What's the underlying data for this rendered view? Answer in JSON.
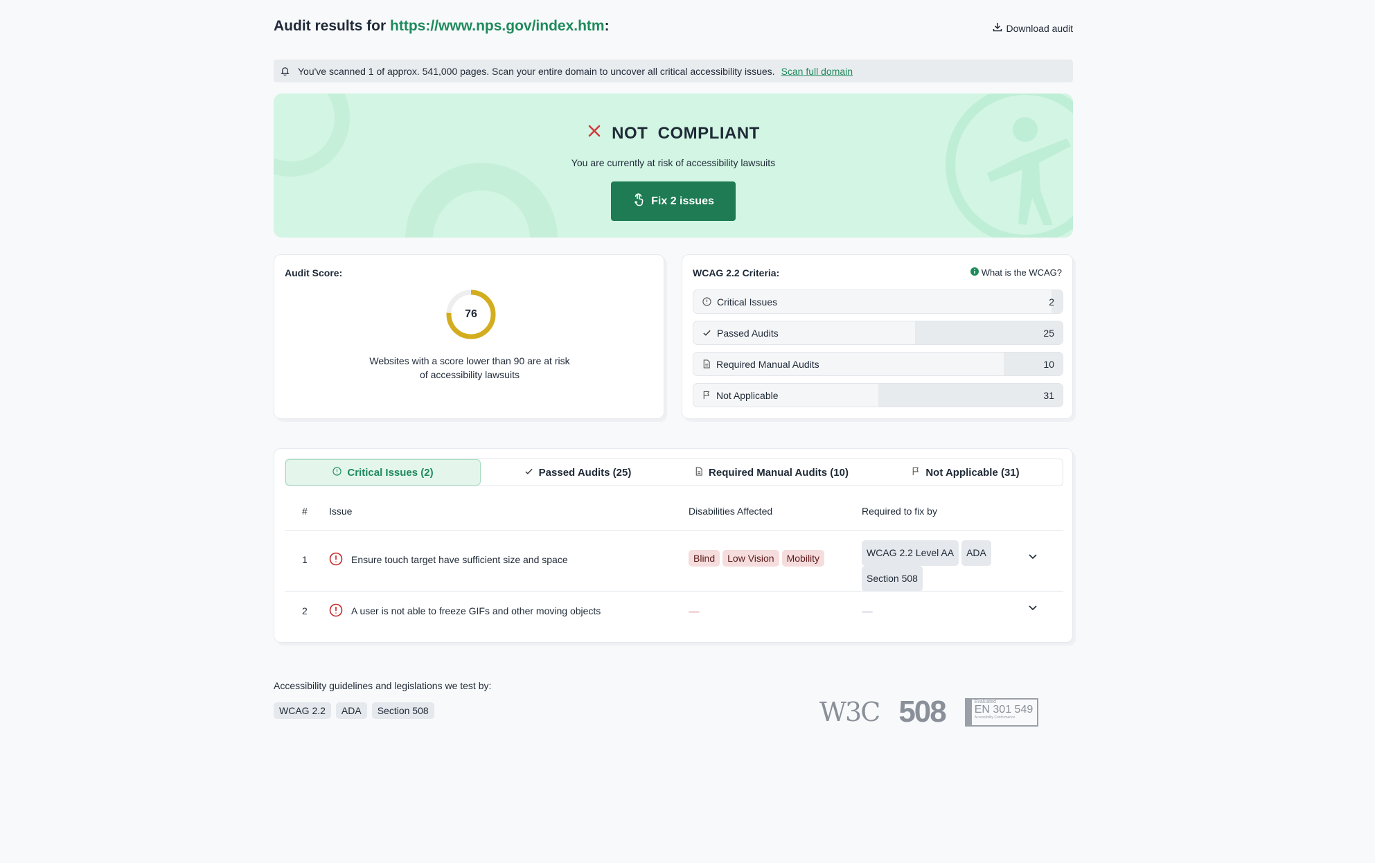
{
  "header": {
    "title_prefix": "Audit results for",
    "url": "https://www.nps.gov/index.htm",
    "title_suffix": ":",
    "download_label": "Download audit"
  },
  "notice": {
    "text": "You've scanned 1 of approx. 541,000 pages. Scan your entire domain to uncover all critical accessibility issues.",
    "link": "Scan full domain"
  },
  "hero": {
    "status": "NOT  COMPLIANT",
    "subtitle": "You are currently at risk of accessibility lawsuits",
    "fix_button": "Fix 2 issues"
  },
  "score_card": {
    "title": "Audit Score:",
    "score": 76,
    "score_label": "76",
    "note_line1": "Websites with a score lower than 90 are at risk",
    "note_line2": "of accessibility lawsuits"
  },
  "wcag_card": {
    "title": "WCAG 2.2 Criteria:",
    "link": "What is the WCAG?",
    "rows": [
      {
        "label": "Critical Issues",
        "count": "2",
        "fraction": 0.03
      },
      {
        "label": "Passed Audits",
        "count": "25",
        "fraction": 0.4
      },
      {
        "label": "Required Manual Audits",
        "count": "10",
        "fraction": 0.16
      },
      {
        "label": "Not Applicable",
        "count": "31",
        "fraction": 0.5
      }
    ]
  },
  "tabs": [
    {
      "label": "Critical Issues (2)"
    },
    {
      "label": "Passed Audits (25)"
    },
    {
      "label": "Required Manual Audits (10)"
    },
    {
      "label": "Not Applicable (31)"
    }
  ],
  "table": {
    "headers": {
      "num": "#",
      "issue": "Issue",
      "disabilities": "Disabilities Affected",
      "required": "Required to fix by"
    },
    "rows": [
      {
        "num": "1",
        "issue": "Ensure touch target have sufficient size and space",
        "disabilities": [
          "Blind",
          "Low Vision",
          "Mobility"
        ],
        "required": [
          "WCAG 2.2 Level AA",
          "ADA",
          "Section 508"
        ]
      },
      {
        "num": "2",
        "issue": "A user is not able to freeze GIFs and other moving objects"
      }
    ]
  },
  "footer": {
    "title": "Accessibility guidelines and legislations we test by:",
    "pills": [
      "WCAG 2.2",
      "ADA",
      "Section 508"
    ],
    "logo_w3c": "W3C",
    "logo_508": "508",
    "logo_en_small": "Evaluated",
    "logo_en_big": "EN 301 549",
    "logo_en_sub": "Accessibility Conformance"
  },
  "colors": {
    "accent": "#1e8a5c",
    "button": "#1e7b53",
    "hero_bg": "#d3f5e4",
    "gauge": "#d4ad1f",
    "error": "#d43a3a"
  }
}
